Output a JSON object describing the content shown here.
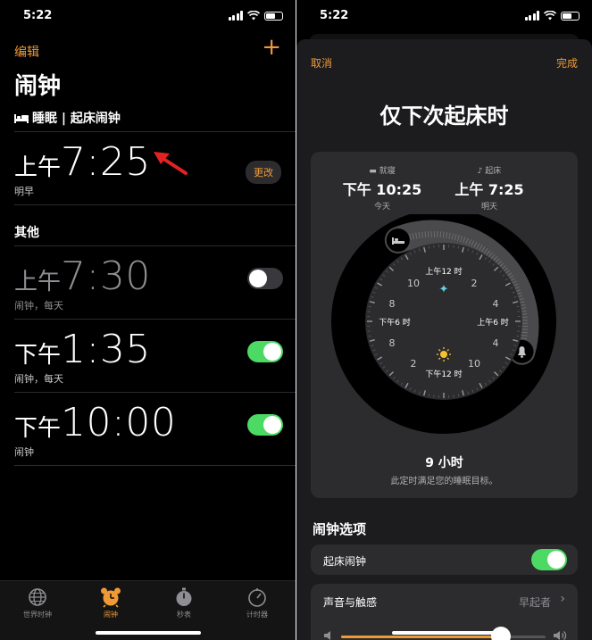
{
  "left": {
    "status": {
      "time": "5:22"
    },
    "nav": {
      "edit": "编辑",
      "add": "+"
    },
    "title": "闹钟",
    "sleep": {
      "header": "睡眠 | 起床闹钟",
      "alarm": {
        "ampm": "上午",
        "time": "7:25",
        "sub": "明早",
        "change": "更改"
      }
    },
    "other": {
      "header": "其他",
      "alarms": [
        {
          "ampm": "上午",
          "time": "7:30",
          "sub": "闹钟，每天",
          "enabled": false
        },
        {
          "ampm": "下午",
          "time": "1:35",
          "sub": "闹钟，每天",
          "enabled": true
        },
        {
          "ampm": "下午",
          "time": "10:00",
          "sub": "闹钟",
          "enabled": true
        }
      ]
    },
    "tabs": [
      {
        "label": "世界时钟",
        "icon": "globe-icon"
      },
      {
        "label": "闹钟",
        "icon": "alarm-clock-icon",
        "active": true
      },
      {
        "label": "秒表",
        "icon": "stopwatch-icon"
      },
      {
        "label": "计时器",
        "icon": "timer-icon"
      }
    ]
  },
  "right": {
    "status": {
      "time": "5:22"
    },
    "cancel": "取消",
    "done": "完成",
    "title": "仅下次起床时",
    "bedtime": {
      "label": "就寝",
      "time": "下午 10:25",
      "day": "今天"
    },
    "wake": {
      "label": "起床",
      "time": "上午 7:25",
      "day": "明天"
    },
    "dial": {
      "numbers": [
        "10",
        "2",
        "8",
        "4",
        "8",
        "4",
        "2",
        "10"
      ],
      "labels": {
        "top": "上午12 时",
        "bottom": "下午12 时",
        "left": "下午6 时",
        "right": "上午6 时"
      }
    },
    "duration": "9 小时",
    "goal": "此定时满足您的睡眠目标。",
    "options": {
      "header": "闹钟选项",
      "wake_alarm": {
        "label": "起床闹钟",
        "enabled": true
      },
      "sound": {
        "label": "声音与触感",
        "value": "早起者"
      },
      "volume": 0.78
    }
  },
  "colors": {
    "accent": "#f09a37",
    "toggle_on": "#4cd964",
    "card": "#2c2c2e",
    "sheet": "#1c1c1e"
  }
}
